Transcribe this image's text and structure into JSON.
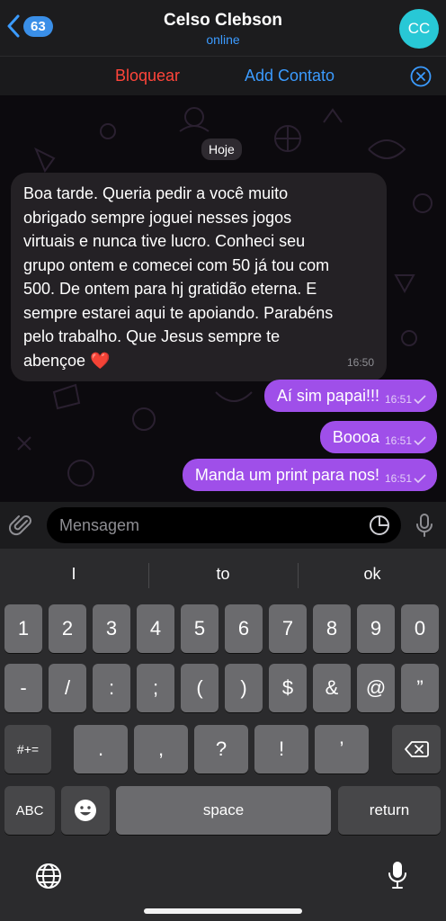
{
  "header": {
    "back_count": "63",
    "title": "Celso Clebson",
    "status": "online",
    "avatar_initials": "CC",
    "avatar_color": "#28c8d6"
  },
  "actions": {
    "block_label": "Bloquear",
    "add_contact_label": "Add Contato"
  },
  "chat": {
    "date_label": "Hoje",
    "incoming": {
      "lines": [
        "Boa tarde. Queria pedir a você muito",
        "obrigado sempre joguei nesses jogos",
        "virtuais e nunca tive lucro. Conheci seu",
        "grupo ontem e comecei com 50 já tou com",
        "500. De ontem para hj gratidão eterna. E",
        "sempre estarei aqui te apoiando. Parabéns",
        "pelo trabalho. Que Jesus sempre te",
        "abençoe"
      ],
      "emoji": "❤️",
      "time": "16:50"
    },
    "outgoing": [
      {
        "text": "Aí sim papai!!!",
        "time": "16:51"
      },
      {
        "text": "Boooa",
        "time": "16:51"
      },
      {
        "text": "Manda um print para nos!",
        "time": "16:51"
      }
    ]
  },
  "composer": {
    "placeholder": "Mensagem"
  },
  "keyboard": {
    "suggestions": [
      "I",
      "to",
      "ok"
    ],
    "row1": [
      "1",
      "2",
      "3",
      "4",
      "5",
      "6",
      "7",
      "8",
      "9",
      "0"
    ],
    "row2": [
      "-",
      "/",
      ":",
      ";",
      "(",
      ")",
      "$",
      "&",
      "@",
      "”"
    ],
    "row3_left": "#+=",
    "row3": [
      ".",
      ",",
      "?",
      "!",
      "’"
    ],
    "abc_label": "ABC",
    "space_label": "space",
    "return_label": "return"
  },
  "colors": {
    "accent_blue": "#3b9bff",
    "block_red": "#ff453a",
    "outgoing_bubble": "#9f4fe9",
    "incoming_bubble": "#242125"
  }
}
